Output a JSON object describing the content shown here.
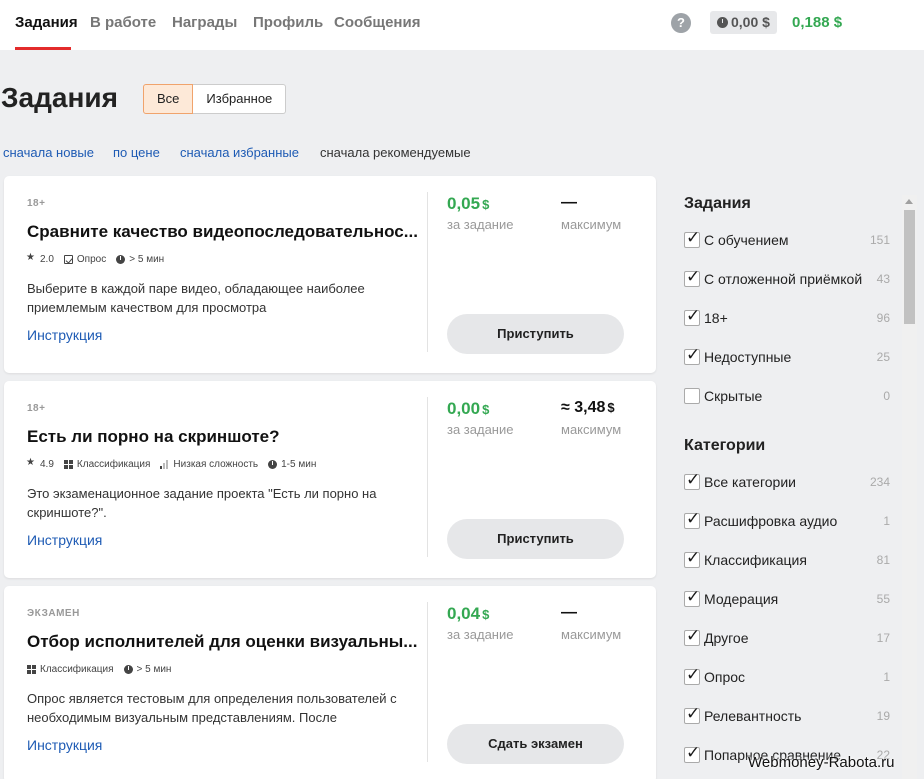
{
  "nav": {
    "tabs": [
      "Задания",
      "В работе",
      "Награды",
      "Профиль",
      "Сообщения"
    ],
    "help": "?",
    "balance": "0,00 $",
    "earned": "0,188 $"
  },
  "page": {
    "title": "Задания",
    "filter_all": "Все",
    "filter_favorites": "Избранное"
  },
  "sort": {
    "newest": "сначала новые",
    "price": "по цене",
    "favorites": "сначала избранные",
    "recommended": "сначала рекомендуемые"
  },
  "cards": [
    {
      "tag": "18+",
      "title": "Сравните качество видеопоследовательнос...",
      "rating": "2.0",
      "type": "Опрос",
      "time": "> 5 мин",
      "description": "Выберите в каждой паре видео, обладающее наиболее приемлемым качеством для просмотра",
      "link": "Инструкция",
      "price": "0,05",
      "price_currency": "$",
      "price_label": "за задание",
      "max": "—",
      "max_label": "максимум",
      "action": "Приступить"
    },
    {
      "tag": "18+",
      "title": "Есть ли порно на скриншоте?",
      "rating": "4.9",
      "type": "Классификация",
      "difficulty": "Низкая сложность",
      "time": "1-5 мин",
      "description": "Это экзаменационное задание проекта \"Есть ли порно на скриншоте?\".",
      "link": "Инструкция",
      "price": "0,00",
      "price_currency": "$",
      "price_label": "за задание",
      "max": "≈ 3,48",
      "max_currency": "$",
      "max_label": "максимум",
      "action": "Приступить"
    },
    {
      "tag": "ЭКЗАМЕН",
      "title": "Отбор исполнителей для оценки визуальны...",
      "type": "Классификация",
      "time": "> 5 мин",
      "description": "Опрос является тестовым для определения пользователей с необходимым визуальным представлениям. После",
      "link": "Инструкция",
      "price": "0,04",
      "price_currency": "$",
      "price_label": "за задание",
      "max": "—",
      "max_label": "максимум",
      "action": "Сдать экзамен"
    }
  ],
  "sidebar": {
    "tasks_heading": "Задания",
    "tasks": [
      {
        "label": "С обучением",
        "count": "151",
        "checked": true
      },
      {
        "label": "С отложенной приёмкой",
        "count": "43",
        "checked": true
      },
      {
        "label": "18+",
        "count": "96",
        "checked": true
      },
      {
        "label": "Недоступные",
        "count": "25",
        "checked": true
      },
      {
        "label": "Скрытые",
        "count": "0",
        "checked": false
      }
    ],
    "categories_heading": "Категории",
    "categories": [
      {
        "label": "Все категории",
        "count": "234",
        "checked": true
      },
      {
        "label": "Расшифровка аудио",
        "count": "1",
        "checked": true
      },
      {
        "label": "Классификация",
        "count": "81",
        "checked": true
      },
      {
        "label": "Модерация",
        "count": "55",
        "checked": true
      },
      {
        "label": "Другое",
        "count": "17",
        "checked": true
      },
      {
        "label": "Опрос",
        "count": "1",
        "checked": true
      },
      {
        "label": "Релевантность",
        "count": "19",
        "checked": true
      },
      {
        "label": "Попарное сравнение",
        "count": "22",
        "checked": true
      }
    ]
  },
  "watermark": "Webmoney-Rabota.ru"
}
